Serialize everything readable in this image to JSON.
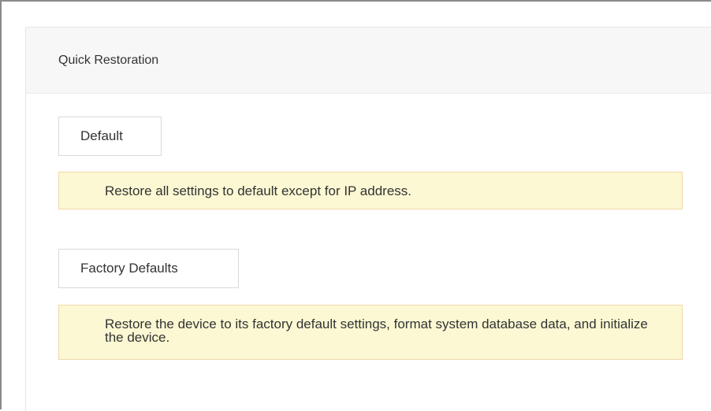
{
  "panel": {
    "title": "Quick Restoration"
  },
  "default_section": {
    "button_label": "Default",
    "note": "Restore all settings to default except for IP address."
  },
  "factory_section": {
    "button_label": "Factory Defaults",
    "note": "Restore the device to its factory default settings, format system database data, and initialize the device."
  },
  "colors": {
    "note_background": "#fbf8d3",
    "note_border": "#f2d7a8",
    "header_background": "#f7f7f7"
  }
}
